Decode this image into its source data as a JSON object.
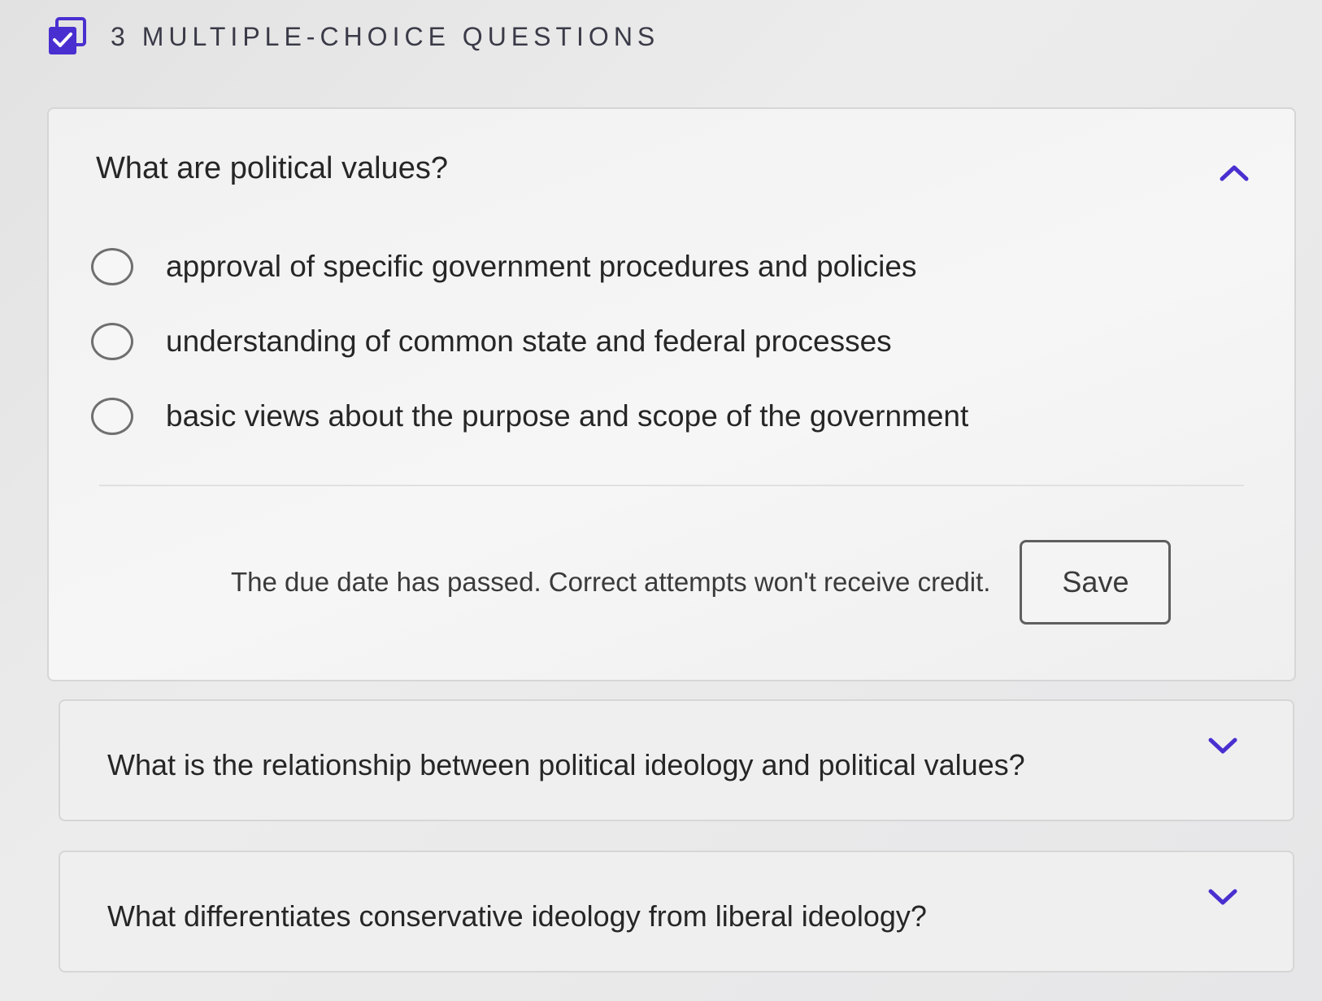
{
  "header": {
    "icon": "checkbox-icon",
    "title": "3 MULTIPLE-CHOICE QUESTIONS",
    "accent_color": "#4a2fd0"
  },
  "questions": [
    {
      "text": "What are political values?",
      "expanded": true,
      "options": [
        "approval of specific government procedures and policies",
        "understanding of common state and federal processes",
        "basic views about the purpose and scope of the government"
      ],
      "due_message": "The due date has passed. Correct attempts won't receive credit.",
      "save_label": "Save"
    },
    {
      "text": "What is the relationship between political ideology and political values?",
      "expanded": false
    },
    {
      "text": "What differentiates conservative ideology from liberal ideology?",
      "expanded": false
    }
  ]
}
